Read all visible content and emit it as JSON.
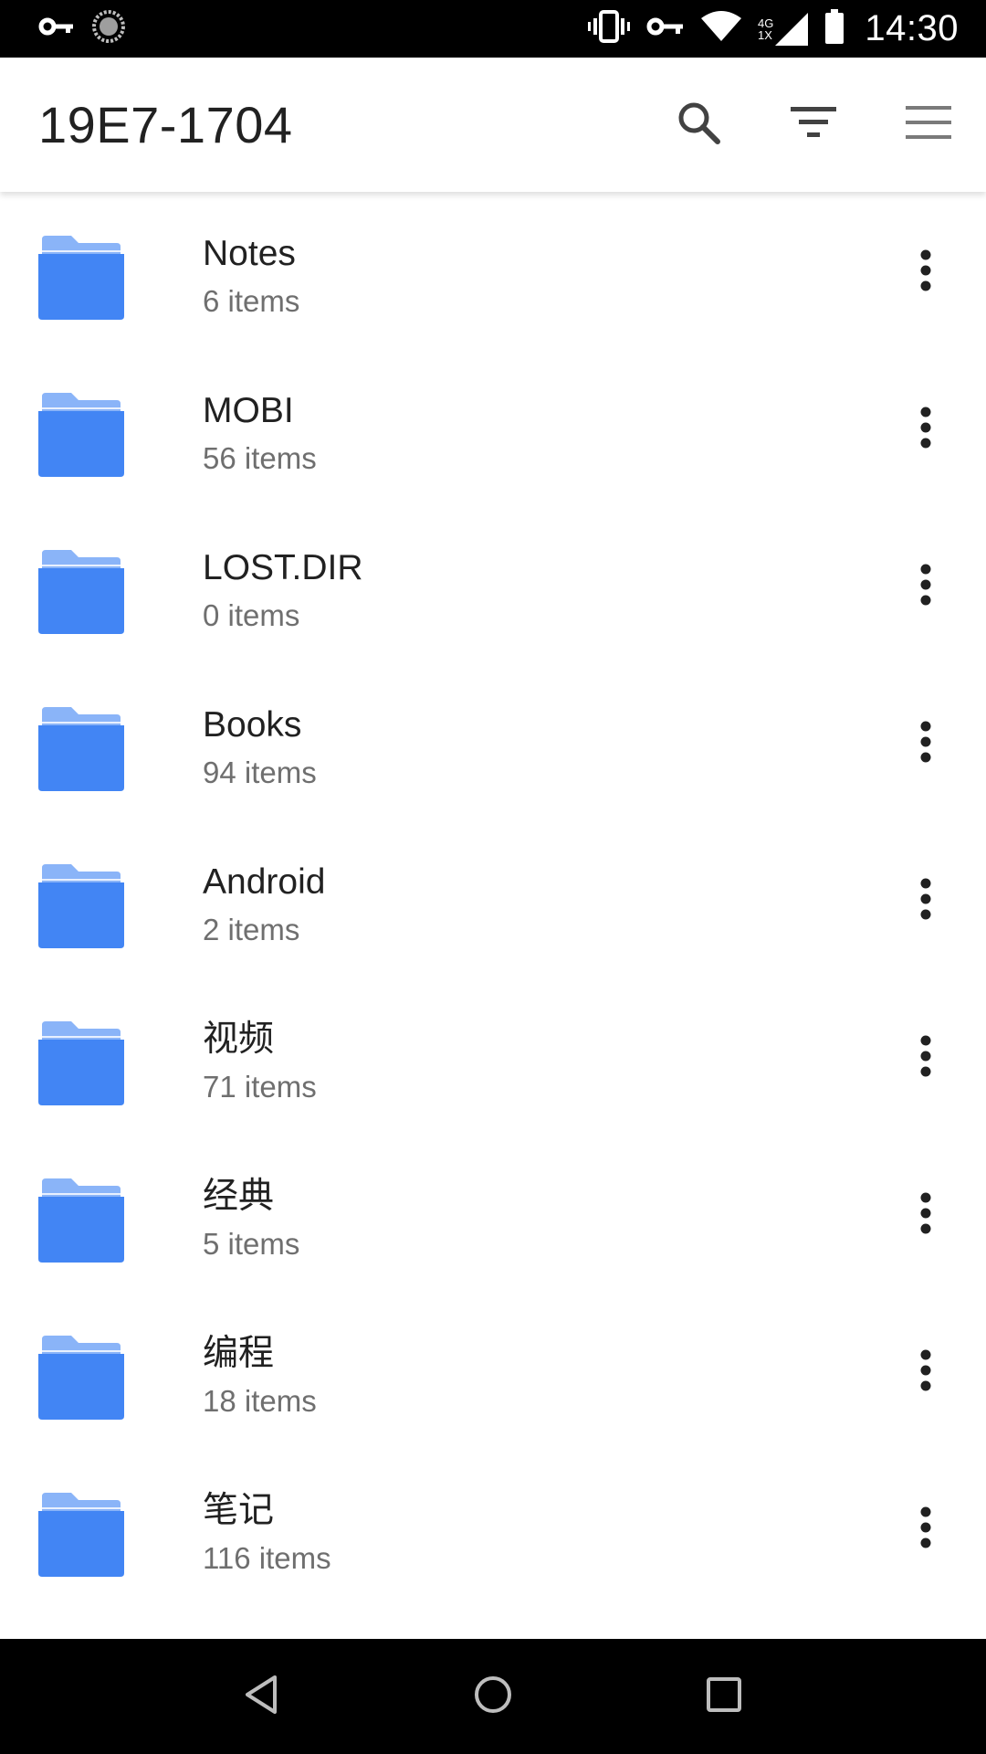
{
  "status_bar": {
    "time": "14:30",
    "network": {
      "type": "4G",
      "sub": "1X"
    },
    "icons": [
      "vpn-key-icon",
      "sync-icon",
      "vibrate-icon",
      "vpn-key-icon",
      "wifi-icon",
      "cell-signal-icon",
      "battery-icon"
    ]
  },
  "app_bar": {
    "title": "19E7-1704",
    "actions": [
      "search-icon",
      "filter-icon",
      "menu-icon"
    ]
  },
  "folders": [
    {
      "name": "Notes",
      "count": "6 items"
    },
    {
      "name": "MOBI",
      "count": "56 items"
    },
    {
      "name": "LOST.DIR",
      "count": "0 items"
    },
    {
      "name": "Books",
      "count": "94 items"
    },
    {
      "name": "Android",
      "count": "2 items"
    },
    {
      "name": "视频",
      "count": "71 items"
    },
    {
      "name": "经典",
      "count": "5 items"
    },
    {
      "name": "编程",
      "count": "18 items"
    },
    {
      "name": "笔记",
      "count": "116 items"
    }
  ],
  "nav_bar": {
    "buttons": [
      "back-icon",
      "home-icon",
      "recents-icon"
    ]
  },
  "colors": {
    "folder": "#4285f4",
    "folder_back": "#8ab4f8",
    "text_primary": "#212121",
    "text_secondary": "#6f6f6f"
  }
}
